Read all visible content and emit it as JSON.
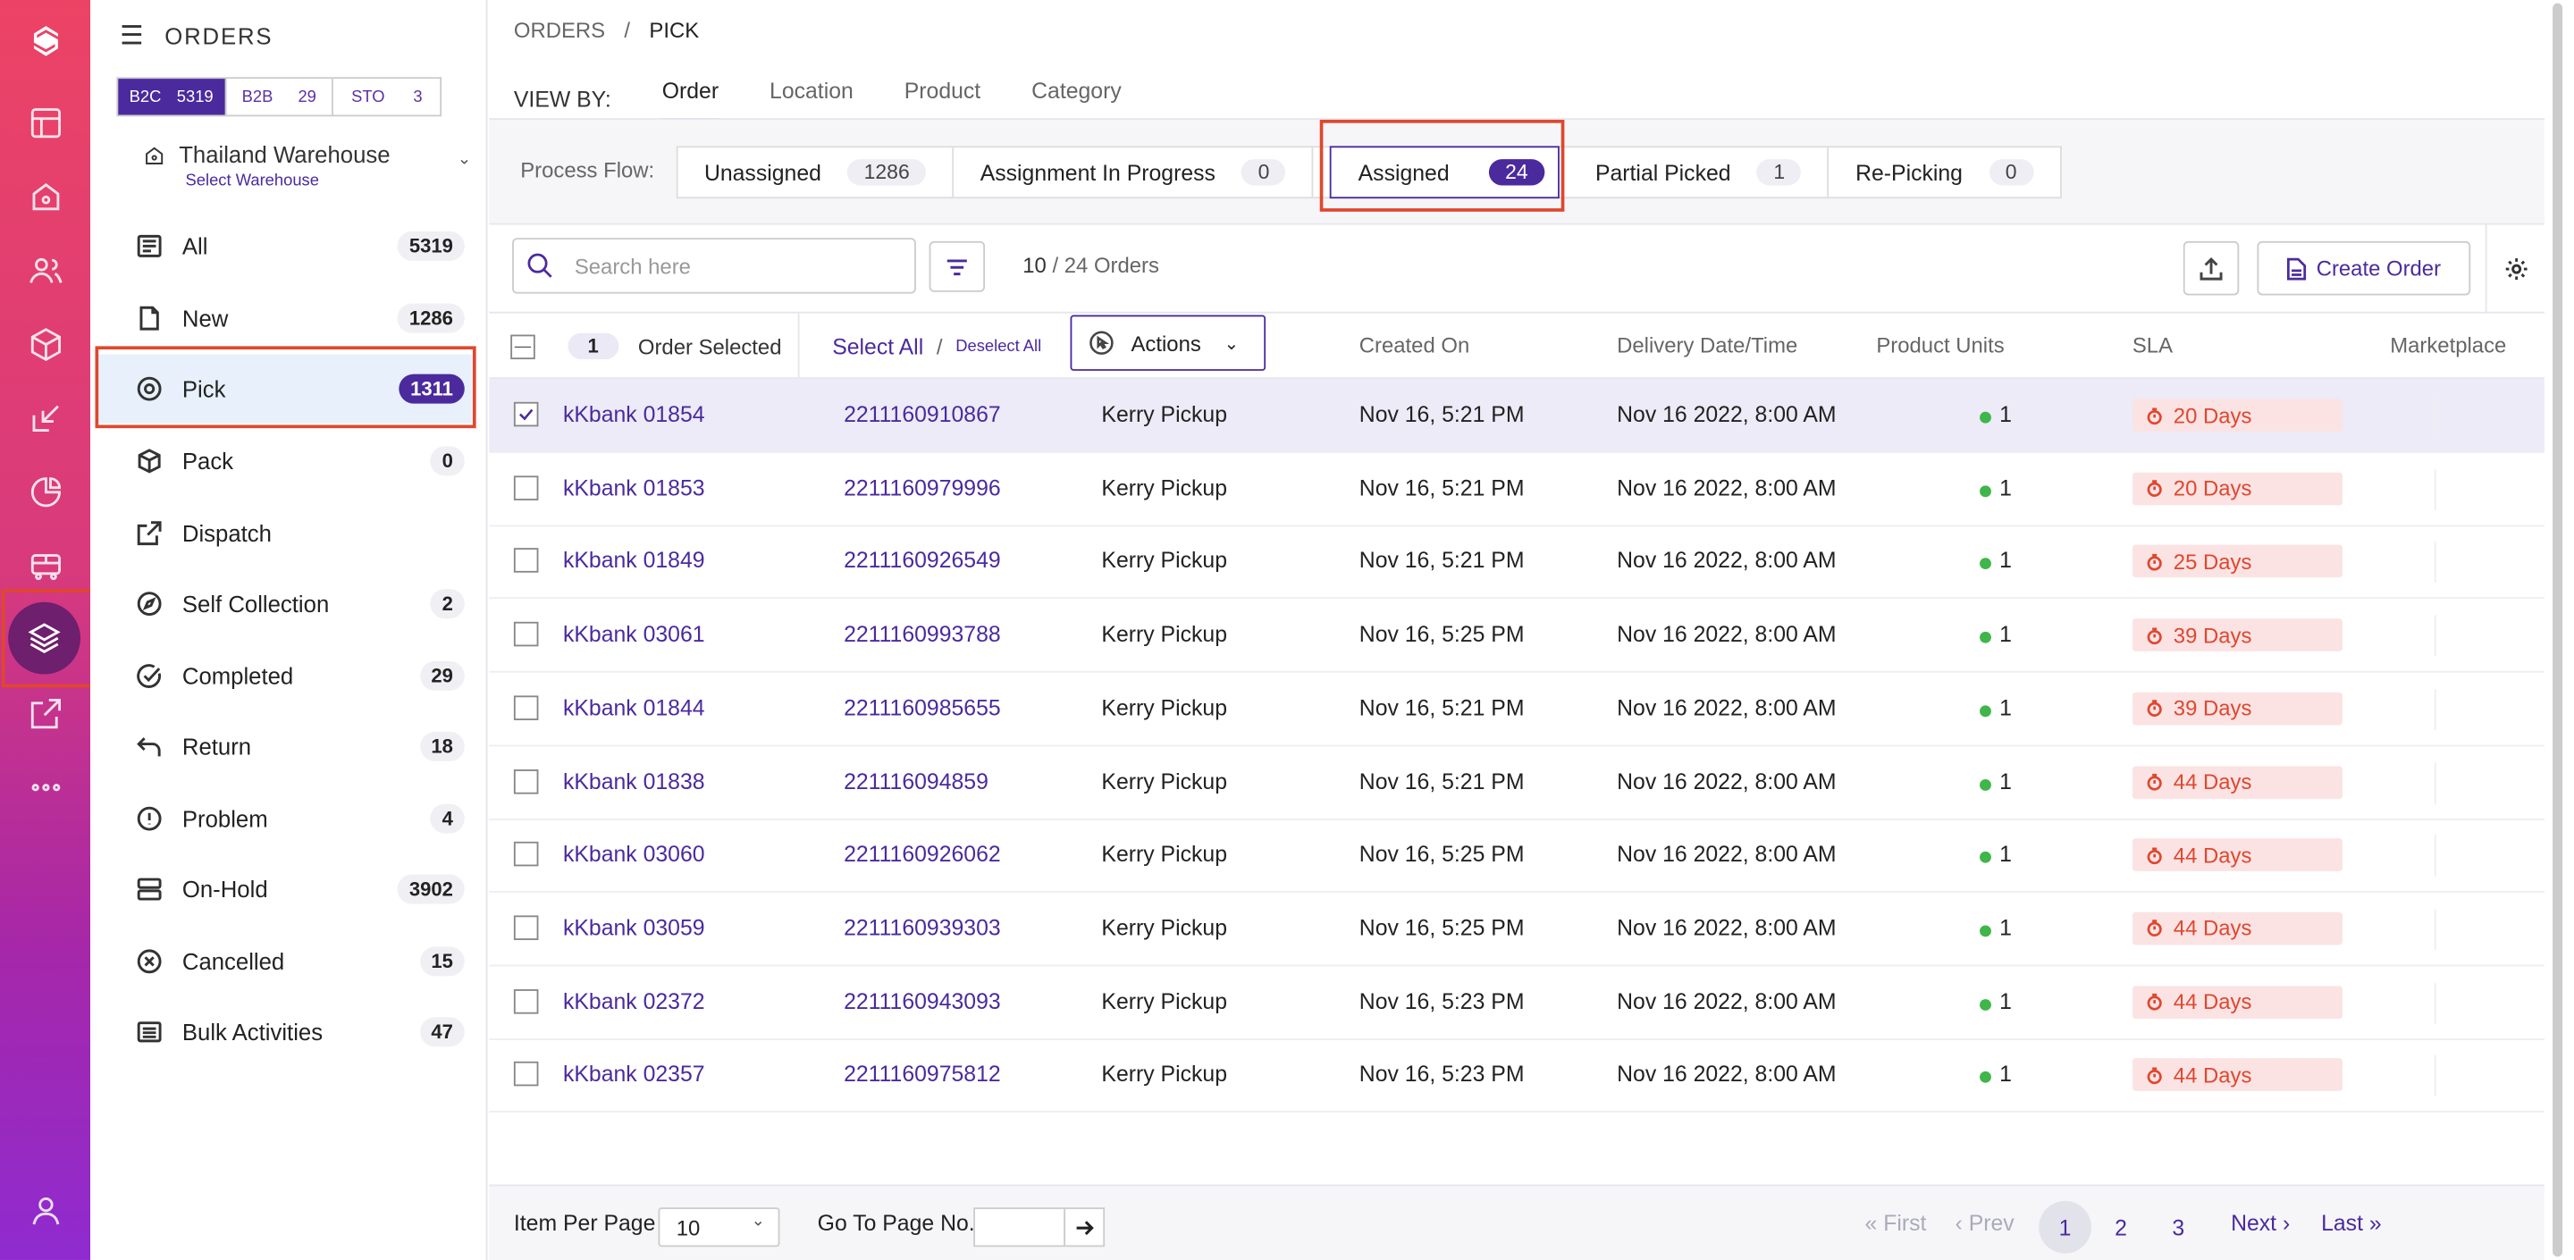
{
  "sidebar": {
    "title": "ORDERS",
    "channels": [
      {
        "label": "B2C",
        "count": "5319"
      },
      {
        "label": "B2B",
        "count": "29"
      },
      {
        "label": "STO",
        "count": "3"
      }
    ],
    "warehouse": {
      "name": "Thailand Warehouse",
      "select_label": "Select Warehouse"
    },
    "items": [
      {
        "label": "All",
        "count": "5319"
      },
      {
        "label": "New",
        "count": "1286"
      },
      {
        "label": "Pick",
        "count": "1311"
      },
      {
        "label": "Pack",
        "count": "0"
      },
      {
        "label": "Dispatch",
        "count": ""
      },
      {
        "label": "Self Collection",
        "count": "2"
      },
      {
        "label": "Completed",
        "count": "29"
      },
      {
        "label": "Return",
        "count": "18"
      },
      {
        "label": "Problem",
        "count": "4"
      },
      {
        "label": "On-Hold",
        "count": "3902"
      },
      {
        "label": "Cancelled",
        "count": "15"
      },
      {
        "label": "Bulk Activities",
        "count": "47"
      }
    ]
  },
  "breadcrumb": {
    "root": "ORDERS",
    "sep": "/",
    "current": "PICK"
  },
  "viewby": {
    "label": "VIEW BY:",
    "tabs": [
      "Order",
      "Location",
      "Product",
      "Category"
    ]
  },
  "process_flow": {
    "label": "Process Flow:",
    "steps": [
      {
        "label": "Unassigned",
        "count": "1286"
      },
      {
        "label": "Assignment In Progress",
        "count": "0"
      },
      {
        "label": "Assigned",
        "count": "24"
      },
      {
        "label": "Partial Picked",
        "count": "1"
      },
      {
        "label": "Re-Picking",
        "count": "0"
      }
    ]
  },
  "toolbar": {
    "search_placeholder": "Search here",
    "shown": "10",
    "total": "/ 24 Orders",
    "create_label": "Create Order"
  },
  "table": {
    "selected_count": "1",
    "selected_text": "Order Selected",
    "select_all": "Select All",
    "slash": "/",
    "deselect_all": "Deselect All",
    "actions_label": "Actions",
    "headers": [
      "Created On",
      "Delivery Date/Time",
      "Product Units",
      "SLA",
      "Marketplace"
    ],
    "rows": [
      {
        "order": "kKbank 01854",
        "ref": "2211160910867",
        "carrier": "Kerry Pickup",
        "created": "Nov 16, 5:21 PM",
        "delivery": "Nov 16 2022, 8:00 AM",
        "units": "1",
        "sla": "20 Days"
      },
      {
        "order": "kKbank 01853",
        "ref": "2211160979996",
        "carrier": "Kerry Pickup",
        "created": "Nov 16, 5:21 PM",
        "delivery": "Nov 16 2022, 8:00 AM",
        "units": "1",
        "sla": "20 Days"
      },
      {
        "order": "kKbank 01849",
        "ref": "2211160926549",
        "carrier": "Kerry Pickup",
        "created": "Nov 16, 5:21 PM",
        "delivery": "Nov 16 2022, 8:00 AM",
        "units": "1",
        "sla": "25 Days"
      },
      {
        "order": "kKbank 03061",
        "ref": "2211160993788",
        "carrier": "Kerry Pickup",
        "created": "Nov 16, 5:25 PM",
        "delivery": "Nov 16 2022, 8:00 AM",
        "units": "1",
        "sla": "39 Days"
      },
      {
        "order": "kKbank 01844",
        "ref": "2211160985655",
        "carrier": "Kerry Pickup",
        "created": "Nov 16, 5:21 PM",
        "delivery": "Nov 16 2022, 8:00 AM",
        "units": "1",
        "sla": "39 Days"
      },
      {
        "order": "kKbank 01838",
        "ref": "221116094859",
        "carrier": "Kerry Pickup",
        "created": "Nov 16, 5:21 PM",
        "delivery": "Nov 16 2022, 8:00 AM",
        "units": "1",
        "sla": "44 Days"
      },
      {
        "order": "kKbank 03060",
        "ref": "2211160926062",
        "carrier": "Kerry Pickup",
        "created": "Nov 16, 5:25 PM",
        "delivery": "Nov 16 2022, 8:00 AM",
        "units": "1",
        "sla": "44 Days"
      },
      {
        "order": "kKbank 03059",
        "ref": "2211160939303",
        "carrier": "Kerry Pickup",
        "created": "Nov 16, 5:25 PM",
        "delivery": "Nov 16 2022, 8:00 AM",
        "units": "1",
        "sla": "44 Days"
      },
      {
        "order": "kKbank 02372",
        "ref": "2211160943093",
        "carrier": "Kerry Pickup",
        "created": "Nov 16, 5:23 PM",
        "delivery": "Nov 16 2022, 8:00 AM",
        "units": "1",
        "sla": "44 Days"
      },
      {
        "order": "kKbank 02357",
        "ref": "2211160975812",
        "carrier": "Kerry Pickup",
        "created": "Nov 16, 5:23 PM",
        "delivery": "Nov 16 2022, 8:00 AM",
        "units": "1",
        "sla": "44 Days"
      }
    ]
  },
  "footer": {
    "items_per_page_label": "Item Per Page",
    "items_per_page_value": "10",
    "goto_label": "Go To Page No.",
    "first": "First",
    "prev": "Prev",
    "pages": [
      "1",
      "2",
      "3"
    ],
    "next": "Next",
    "last": "Last"
  },
  "colors": {
    "accent": "#4b2a9e",
    "sla_red": "#e0472d",
    "highlight": "#e0472d",
    "status_dot": "#3fb54a"
  }
}
